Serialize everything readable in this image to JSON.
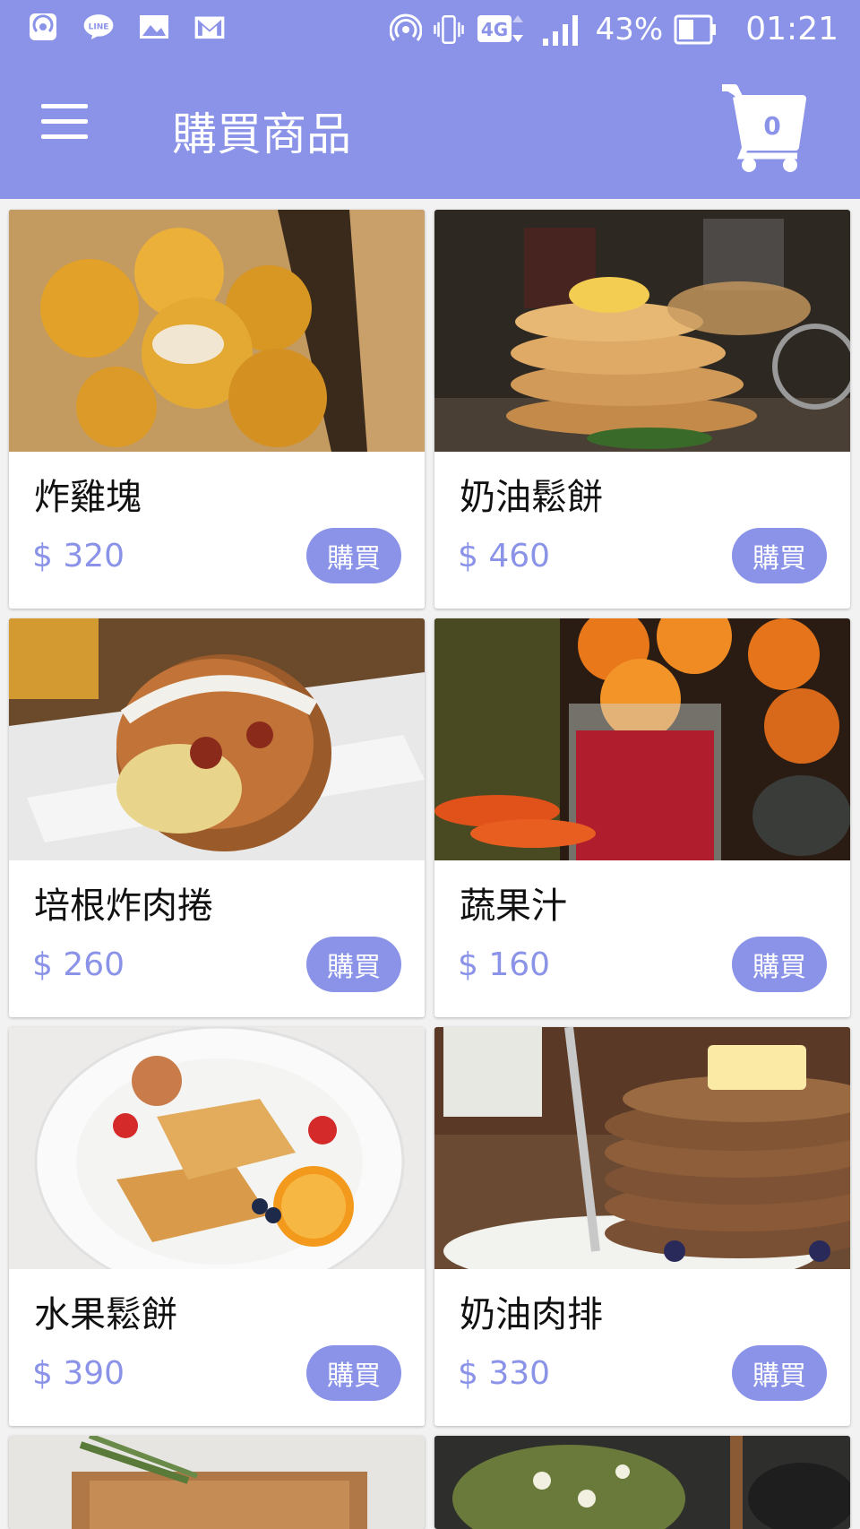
{
  "status_bar": {
    "battery": "43%",
    "time": "01:21",
    "network": "4G",
    "icons": [
      "hotspot-icon",
      "line-icon",
      "gallery-icon",
      "gmail-icon",
      "wifi-hotspot-icon",
      "vibrate-icon",
      "network-4g-icon",
      "signal-icon",
      "battery-icon"
    ]
  },
  "toolbar": {
    "title": "購買商品",
    "cart_count": "0",
    "menu_icon": "hamburger-menu-icon",
    "cart_icon": "shopping-cart-icon"
  },
  "colors": {
    "accent": "#8a93e8",
    "background": "#f2f2f2"
  },
  "products": [
    {
      "name": "炸雞塊",
      "price": "$ 320",
      "buy_label": "購買"
    },
    {
      "name": "奶油鬆餅",
      "price": "$ 460",
      "buy_label": "購買"
    },
    {
      "name": "培根炸肉捲",
      "price": "$ 260",
      "buy_label": "購買"
    },
    {
      "name": "蔬果汁",
      "price": "$ 160",
      "buy_label": "購買"
    },
    {
      "name": "水果鬆餅",
      "price": "$ 390",
      "buy_label": "購買"
    },
    {
      "name": "奶油肉排",
      "price": "$ 330",
      "buy_label": "購買"
    }
  ]
}
